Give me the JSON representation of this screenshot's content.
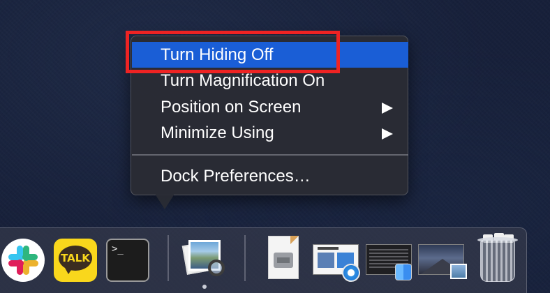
{
  "context_menu": {
    "items": [
      {
        "label": "Turn Hiding Off",
        "highlighted": true,
        "has_submenu": false
      },
      {
        "label": "Turn Magnification On",
        "highlighted": false,
        "has_submenu": false
      },
      {
        "label": "Position on Screen",
        "highlighted": false,
        "has_submenu": true
      },
      {
        "label": "Minimize Using",
        "highlighted": false,
        "has_submenu": true
      }
    ],
    "footer_item": {
      "label": "Dock Preferences…"
    },
    "highlight_color": "#1a5ed6",
    "annotation_color": "#ee2323"
  },
  "dock": {
    "apps": [
      {
        "name": "slack-icon",
        "running": false
      },
      {
        "name": "kakaotalk-icon",
        "label": "TALK",
        "running": false
      },
      {
        "name": "terminal-icon",
        "prompt": ">_",
        "running": false
      },
      {
        "name": "preview-icon",
        "running": true
      },
      {
        "name": "disk-image-document-icon",
        "running": false
      },
      {
        "name": "safari-window-thumbnail",
        "running": false
      },
      {
        "name": "finder-window-thumbnail",
        "running": false
      },
      {
        "name": "preview-window-thumbnail",
        "running": false
      },
      {
        "name": "trash-icon",
        "running": false
      }
    ]
  }
}
